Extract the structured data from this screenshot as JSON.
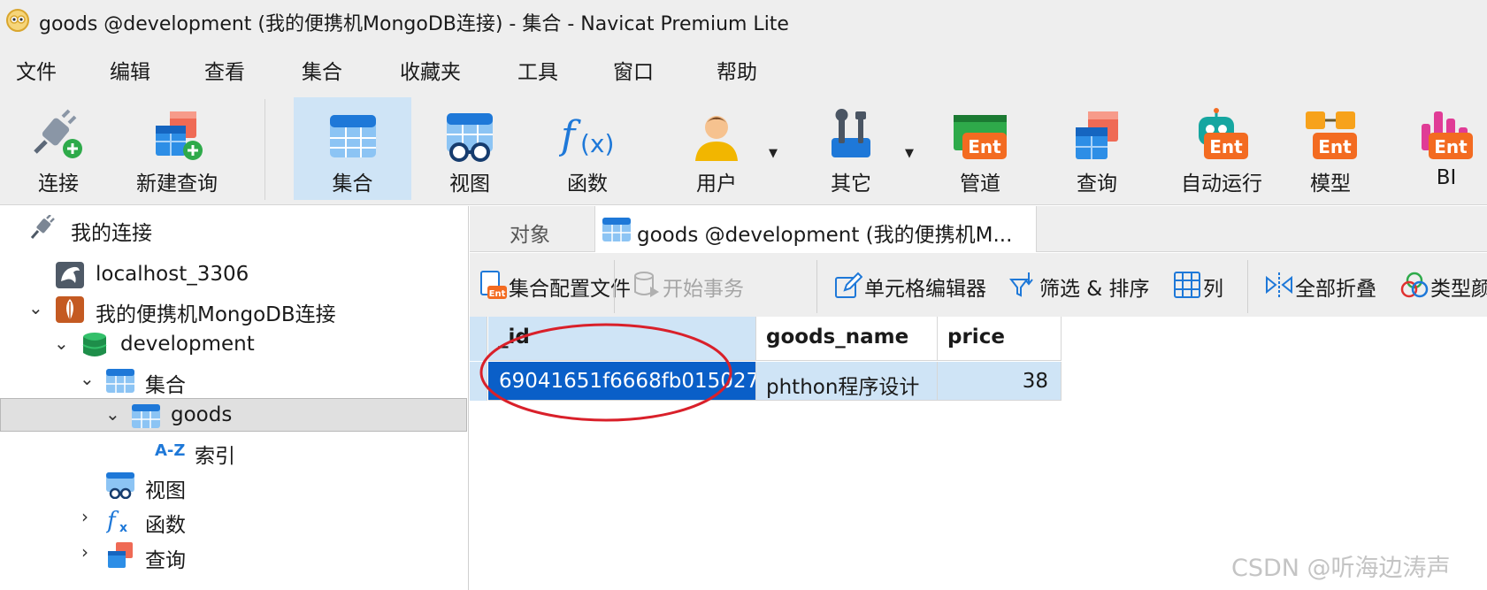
{
  "window": {
    "title": "goods @development (我的便携机MongoDB连接) - 集合 - Navicat Premium Lite"
  },
  "menu": [
    "文件",
    "编辑",
    "查看",
    "集合",
    "收藏夹",
    "工具",
    "窗口",
    "帮助"
  ],
  "toolbar": {
    "items": [
      {
        "label": "连接",
        "icon": "plug-add-icon"
      },
      {
        "label": "新建查询",
        "icon": "new-query-icon"
      },
      {
        "label": "集合",
        "icon": "collection-icon",
        "active": true
      },
      {
        "label": "视图",
        "icon": "view-icon"
      },
      {
        "label": "函数",
        "icon": "function-icon"
      },
      {
        "label": "用户",
        "icon": "user-icon",
        "dropdown": true
      },
      {
        "label": "其它",
        "icon": "tools-icon",
        "dropdown": true
      },
      {
        "label": "管道",
        "icon": "pipeline-ent-icon"
      },
      {
        "label": "查询",
        "icon": "query-icon"
      },
      {
        "label": "自动运行",
        "icon": "robot-ent-icon"
      },
      {
        "label": "模型",
        "icon": "model-ent-icon"
      },
      {
        "label": "BI",
        "icon": "bi-ent-icon"
      }
    ],
    "ent_badge": "Ent"
  },
  "navigator": {
    "root": "我的连接",
    "items": [
      {
        "label": "localhost_3306",
        "icon": "mysql-dolphin-icon"
      },
      {
        "label": "我的便携机MongoDB连接",
        "icon": "mongodb-leaf-icon",
        "expanded": true
      },
      {
        "label": "development",
        "icon": "database-icon",
        "expanded": true
      },
      {
        "label": "集合",
        "icon": "collection-folder-icon",
        "expanded": true
      },
      {
        "label": "goods",
        "icon": "collection-table-icon",
        "expanded": true,
        "selected": true
      },
      {
        "label": "索引",
        "icon": "index-az-icon",
        "prefix": "A-Z"
      },
      {
        "label": "视图",
        "icon": "view-icon"
      },
      {
        "label": "函数",
        "icon": "function-icon"
      },
      {
        "label": "查询",
        "icon": "query-icon"
      }
    ]
  },
  "tabs": {
    "objects": "对象",
    "active": "goods @development (我的便携机M..."
  },
  "subtoolbar": {
    "profile": "集合配置文件",
    "begin_transaction": "开始事务",
    "cell_editor": "单元格编辑器",
    "filter_sort": "筛选 & 排序",
    "columns": "列",
    "collapse_all": "全部折叠",
    "type_color": "类型颜"
  },
  "grid": {
    "columns": [
      "_id",
      "goods_name",
      "price"
    ],
    "rows": [
      {
        "_id": "69041651f6668fb015027",
        "goods_name": "phthon程序设计",
        "price": "38"
      }
    ]
  },
  "colors": {
    "accent_blue": "#0a5fc8",
    "selection_light": "#cfe4f6",
    "annotation_red": "#d9202a"
  },
  "watermark": "CSDN @听海边涛声"
}
